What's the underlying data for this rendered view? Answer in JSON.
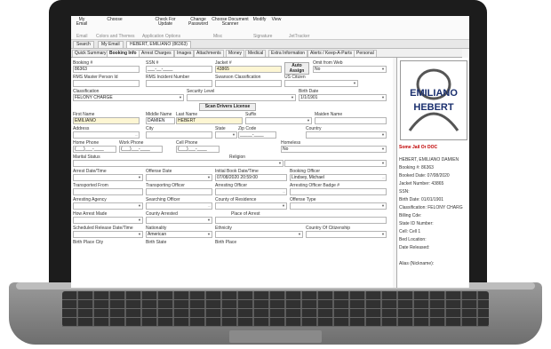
{
  "ribbon": {
    "buttons": [
      "My Email",
      "Choose",
      "Check For Update",
      "Change Password",
      "Choose Document Scanner",
      "Modify",
      "View"
    ],
    "groups": [
      "Email",
      "Colors and Themes",
      "Application Options",
      "Misc",
      "Signature",
      "JetTracker"
    ]
  },
  "window_tabs": [
    "Search",
    "My Email",
    "HEBERT, EMILIANO (86363)"
  ],
  "subtabs": [
    "Quick Summary",
    "Booking Info",
    "Arrest Charges",
    "Images",
    "Attachments",
    "Money",
    "Medical",
    "Extra Information",
    "Alerts / Keep-A-Parts",
    "Personal"
  ],
  "form": {
    "booking_no_label": "Booking #",
    "booking_no": "86363",
    "ssn_label": "SSN #",
    "ssn": "___-__-____",
    "jacket_label": "Jacket #",
    "jacket": "43865",
    "auto_assign": "Auto Assign",
    "omit_web_label": "Omit from Web",
    "omit_web": "No",
    "rms_master_label": "RMS Master Person Id",
    "rms_incident_label": "RMS Incident Number",
    "swanson_label": "Swanson Classification",
    "us_citizen_label": "US Citizen",
    "classification_label": "Classification",
    "classification": "FELONY CHARGE",
    "security_label": "Security Level",
    "birth_date_label": "Birth Date",
    "birth_date": "1/1/1901",
    "scan_license": "Scan Drivers License",
    "first_name_label": "First Name",
    "first_name": "EMILIANO",
    "middle_name_label": "Middle Name",
    "middle_name": "DAMIEN",
    "last_name_label": "Last Name",
    "last_name": "HEBERT",
    "suffix_label": "Suffix",
    "maiden_label": "Maiden Name",
    "address_label": "Address",
    "city_label": "City",
    "state_label": "State",
    "zip_label": "Zip Code",
    "country_label": "Country",
    "home_phone_label": "Home Phone",
    "work_phone_label": "Work Phone",
    "cell_phone_label": "Cell Phone",
    "homeless_label": "Homeless",
    "homeless": "No",
    "phone_mask": "(___)___-____",
    "zip_mask": "_____-____",
    "marital_label": "Marital Status",
    "religion_label": "Religion",
    "arrest_dt_label": "Arrest Date/Time",
    "offense_date_label": "Offense Date",
    "initial_book_label": "Initial Book Date/Time",
    "initial_book": "07/08/2020 20:59:00",
    "booking_officer_label": "Booking Officer",
    "booking_officer": "Lindsey, Michael",
    "transported_from_label": "Transported From",
    "transporting_officer_label": "Transporting Officer",
    "arresting_officer_label": "Arresting Officer",
    "arresting_badge_label": "Arresting Officer Badge #",
    "arresting_agency_label": "Arresting Agency",
    "searching_officer_label": "Searching Officer",
    "county_residence_label": "County of Residence",
    "offense_type_label": "Offense Type",
    "how_arrest_label": "How Arrest Made",
    "county_arrested_label": "County Arrested",
    "place_arrest_label": "Place of Arrest",
    "sched_release_label": "Scheduled Release Date/Time",
    "nationality_label": "Nationality",
    "nationality": "American",
    "ethnicity_label": "Ethnicity",
    "country_citizenship_label": "Country Of Citizenship",
    "birth_city_label": "Birth Place City",
    "birth_state_label": "Birth State",
    "birth_place_label": "Birth Place",
    "ellipsis": "..."
  },
  "side": {
    "first": "EMILIANO",
    "last": "HEBERT",
    "status": "Some Jail Or DOC",
    "lines": [
      "HEBERT, EMILIANO DAMIEN",
      "Booking #: 86363",
      "Booked Date: 07/08/2020",
      "Jacket Number: 43865",
      "SSN:",
      "Birth Date: 01/01/1901",
      "Classification: FELONY CHARG",
      "Billing Cde:",
      "State ID Number:",
      "Cell: Cell 1",
      "Bed Location:",
      "Date Released:",
      "",
      "Alias (Nickname):"
    ]
  },
  "colors": {
    "yellow_field": "#fdf6d3",
    "name_blue": "#1a2f6e",
    "status_red": "#c00000"
  }
}
